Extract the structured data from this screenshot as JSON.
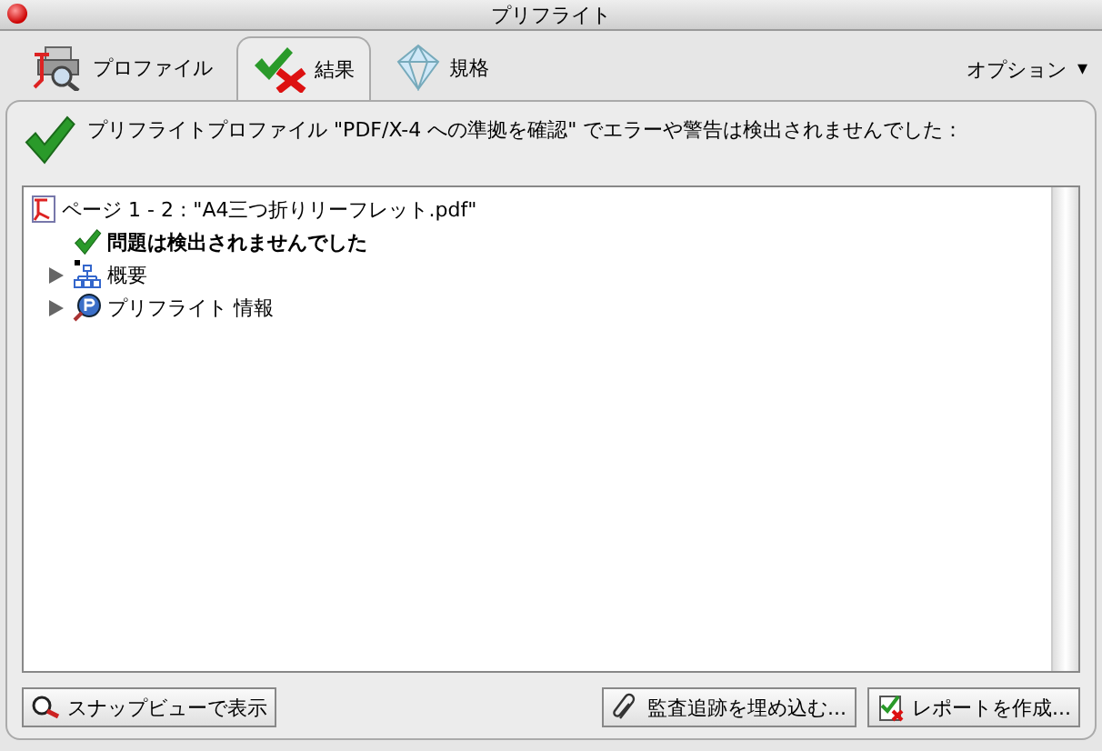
{
  "window": {
    "title": "プリフライト"
  },
  "tabs": [
    {
      "label": "プロファイル",
      "kind": "profile",
      "selected": false
    },
    {
      "label": "結果",
      "kind": "result",
      "selected": true
    },
    {
      "label": "規格",
      "kind": "standard",
      "selected": false
    }
  ],
  "options_menu": {
    "label": "オプション",
    "caret": "▾"
  },
  "message": "プリフライトプロファイル \"PDF/X-4 への準拠を確認\" でエラーや警告は検出されませんでした：",
  "tree": [
    {
      "kind": "file",
      "label": "ページ 1 - 2 : \"A4三つ折りリーフレット.pdf\"",
      "children": [
        {
          "kind": "check",
          "label": "問題は検出されませんでした"
        },
        {
          "kind": "overview",
          "label": "概要",
          "expanded": false
        },
        {
          "kind": "info",
          "label": "プリフライト 情報",
          "expanded": false
        }
      ]
    }
  ],
  "buttons_left": [
    {
      "label": "スナップビューで表示",
      "kind": "snap"
    }
  ],
  "buttons_right": [
    {
      "label": "監査追跡を埋め込む...",
      "kind": "clip"
    },
    {
      "label": "レポートを作成...",
      "kind": "report"
    }
  ]
}
